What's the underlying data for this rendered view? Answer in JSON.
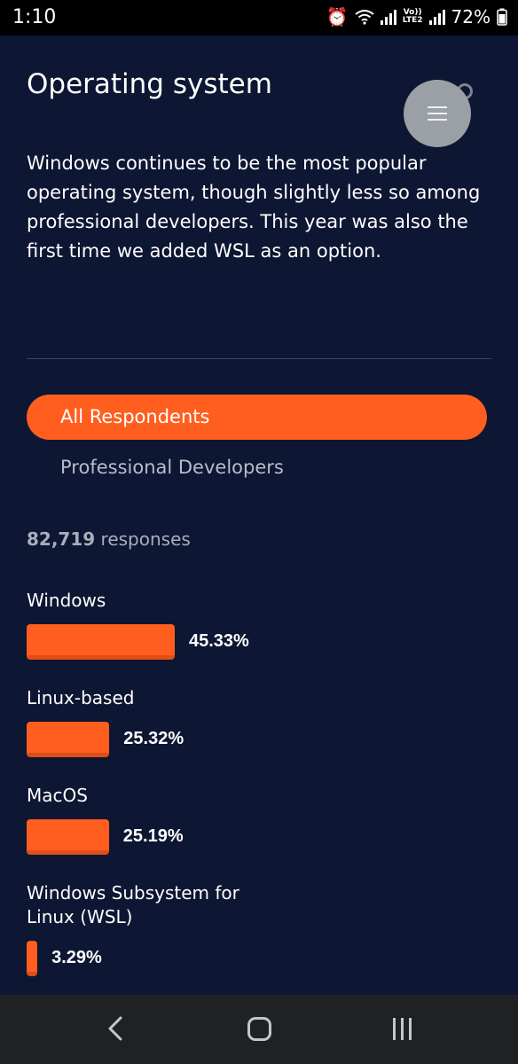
{
  "status_bar": {
    "time": "1:10",
    "battery": "72%",
    "network": "LTE2",
    "volte": "Vo))"
  },
  "page": {
    "title": "Operating system",
    "description": "Windows continues to be the most popular operating system, though slightly less so among professional developers. This year was also the first time we added WSL as an option."
  },
  "filters": {
    "active": "All Respondents",
    "inactive": "Professional Developers"
  },
  "responses": {
    "count": "82,719",
    "label": "responses"
  },
  "accent_color": "#ff5e1f",
  "chart_data": {
    "type": "bar",
    "categories": [
      "Windows",
      "Linux-based",
      "MacOS",
      "Windows Subsystem for Linux (WSL)"
    ],
    "values": [
      45.33,
      25.32,
      25.19,
      3.29
    ],
    "value_labels": [
      "45.33%",
      "25.32%",
      "25.19%",
      "3.29%"
    ]
  },
  "icons": {
    "menu": "menu-icon",
    "back": "back-icon",
    "home": "home-icon",
    "recents": "recents-icon"
  }
}
